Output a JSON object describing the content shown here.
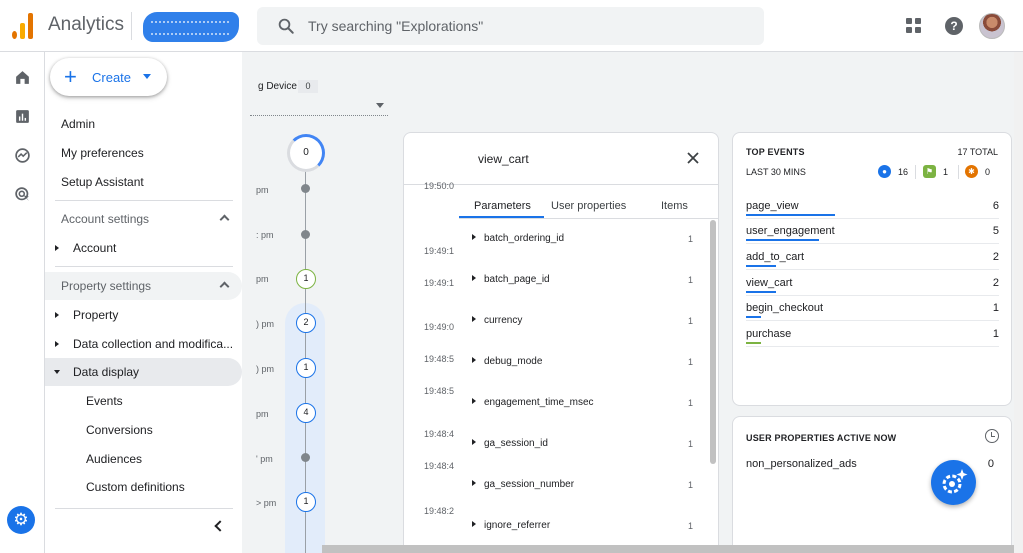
{
  "header": {
    "app_title": "Analytics",
    "search_placeholder": "Try searching \"Explorations\""
  },
  "create": {
    "label": "Create"
  },
  "nav": {
    "items": [
      {
        "label": "Admin"
      },
      {
        "label": "My preferences"
      },
      {
        "label": "Setup Assistant"
      },
      {
        "label": "Account settings"
      },
      {
        "label": "Account"
      },
      {
        "label": "Property settings"
      },
      {
        "label": "Property"
      },
      {
        "label": "Data collection and modifica..."
      },
      {
        "label": "Data display"
      },
      {
        "label": "Events"
      },
      {
        "label": "Conversions"
      },
      {
        "label": "Audiences"
      },
      {
        "label": "Custom definitions"
      }
    ]
  },
  "debug": {
    "device_label": "g Device",
    "device_count": "0",
    "top_count": "0",
    "time_fragments": [
      "pm",
      ": pm",
      "pm",
      ") pm",
      ") pm",
      "pm",
      "' pm",
      "> pm"
    ],
    "timeline_counts": [
      "1",
      "2",
      "1",
      "4",
      "1"
    ]
  },
  "event_detail": {
    "title": "view_cart",
    "tabs": [
      "Parameters",
      "User properties",
      "Items"
    ],
    "timestamps": [
      "19:50:0",
      "19:49:1",
      "19:49:1",
      "19:49:0",
      "19:48:5",
      "19:48:5",
      "19:48:4",
      "19:48:4",
      "19:48:2"
    ],
    "params": [
      {
        "name": "batch_ordering_id",
        "count": "1"
      },
      {
        "name": "batch_page_id",
        "count": "1"
      },
      {
        "name": "currency",
        "count": "1"
      },
      {
        "name": "debug_mode",
        "count": "1"
      },
      {
        "name": "engagement_time_msec",
        "count": "1"
      },
      {
        "name": "ga_session_id",
        "count": "1"
      },
      {
        "name": "ga_session_number",
        "count": "1"
      },
      {
        "name": "ignore_referrer",
        "count": "1"
      }
    ]
  },
  "top_events": {
    "title": "TOP EVENTS",
    "total": "17 TOTAL",
    "subtitle": "LAST 30 MINS",
    "badges": [
      {
        "count": "16",
        "color": "#1a73e8"
      },
      {
        "count": "1",
        "color": "#7cb342"
      },
      {
        "count": "0",
        "color": "#e37400"
      }
    ],
    "events": [
      {
        "name": "page_view",
        "count": "6",
        "bar": 0.35,
        "color": "#1a73e8"
      },
      {
        "name": "user_engagement",
        "count": "5",
        "bar": 0.29,
        "color": "#1a73e8"
      },
      {
        "name": "add_to_cart",
        "count": "2",
        "bar": 0.12,
        "color": "#1a73e8"
      },
      {
        "name": "view_cart",
        "count": "2",
        "bar": 0.12,
        "color": "#1a73e8"
      },
      {
        "name": "begin_checkout",
        "count": "1",
        "bar": 0.06,
        "color": "#1a73e8"
      },
      {
        "name": "purchase",
        "count": "1",
        "bar": 0.06,
        "color": "#7cb342"
      }
    ]
  },
  "user_properties": {
    "title": "USER PROPERTIES ACTIVE NOW",
    "items": [
      {
        "name": "non_personalized_ads",
        "value": "0"
      }
    ]
  }
}
